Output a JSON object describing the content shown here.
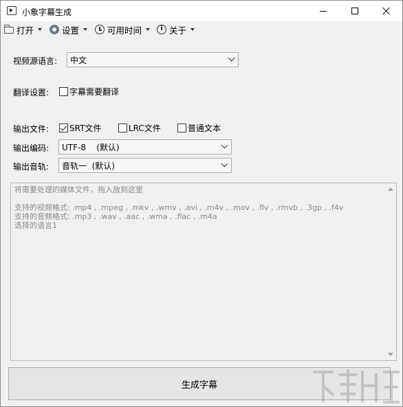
{
  "window": {
    "title": "小象字幕生成"
  },
  "menu": [
    {
      "label": "打开",
      "icon": "folder-icon"
    },
    {
      "label": "设置",
      "icon": "gear-icon"
    },
    {
      "label": "可用时间",
      "icon": "clock-icon"
    },
    {
      "label": "关于",
      "icon": "info-icon"
    }
  ],
  "form": {
    "source_language": {
      "label": "视频源语言:",
      "value": "中文"
    },
    "translate": {
      "label": "翻译设置:",
      "option": "字幕需要翻译",
      "checked": false
    },
    "output_file": {
      "label": "输出文件:",
      "options": [
        {
          "label": "SRT文件",
          "checked": true
        },
        {
          "label": "LRC文件",
          "checked": false
        },
        {
          "label": "普通文本",
          "checked": false
        }
      ]
    },
    "encoding": {
      "label": "输出编码:",
      "value": "UTF-8    (默认)"
    },
    "audio_track": {
      "label": "输出音轨:",
      "value": "音轨一  (默认)"
    }
  },
  "droparea": {
    "hint": "将需要处理的媒体文件，拖入放到这里",
    "video_formats": "支持的视频格式: .mp4 , .mpeg , .mkv , .wmv , .avi , .m4v , .mov , .flv , .rmvb , .3gp , .f4v",
    "audio_formats": "支持的音频格式: .mp3 , .wav , .aac , .wma , .flac , .m4a",
    "selected_language": "选择的语言1"
  },
  "generate_button": {
    "label": "生成字幕"
  }
}
